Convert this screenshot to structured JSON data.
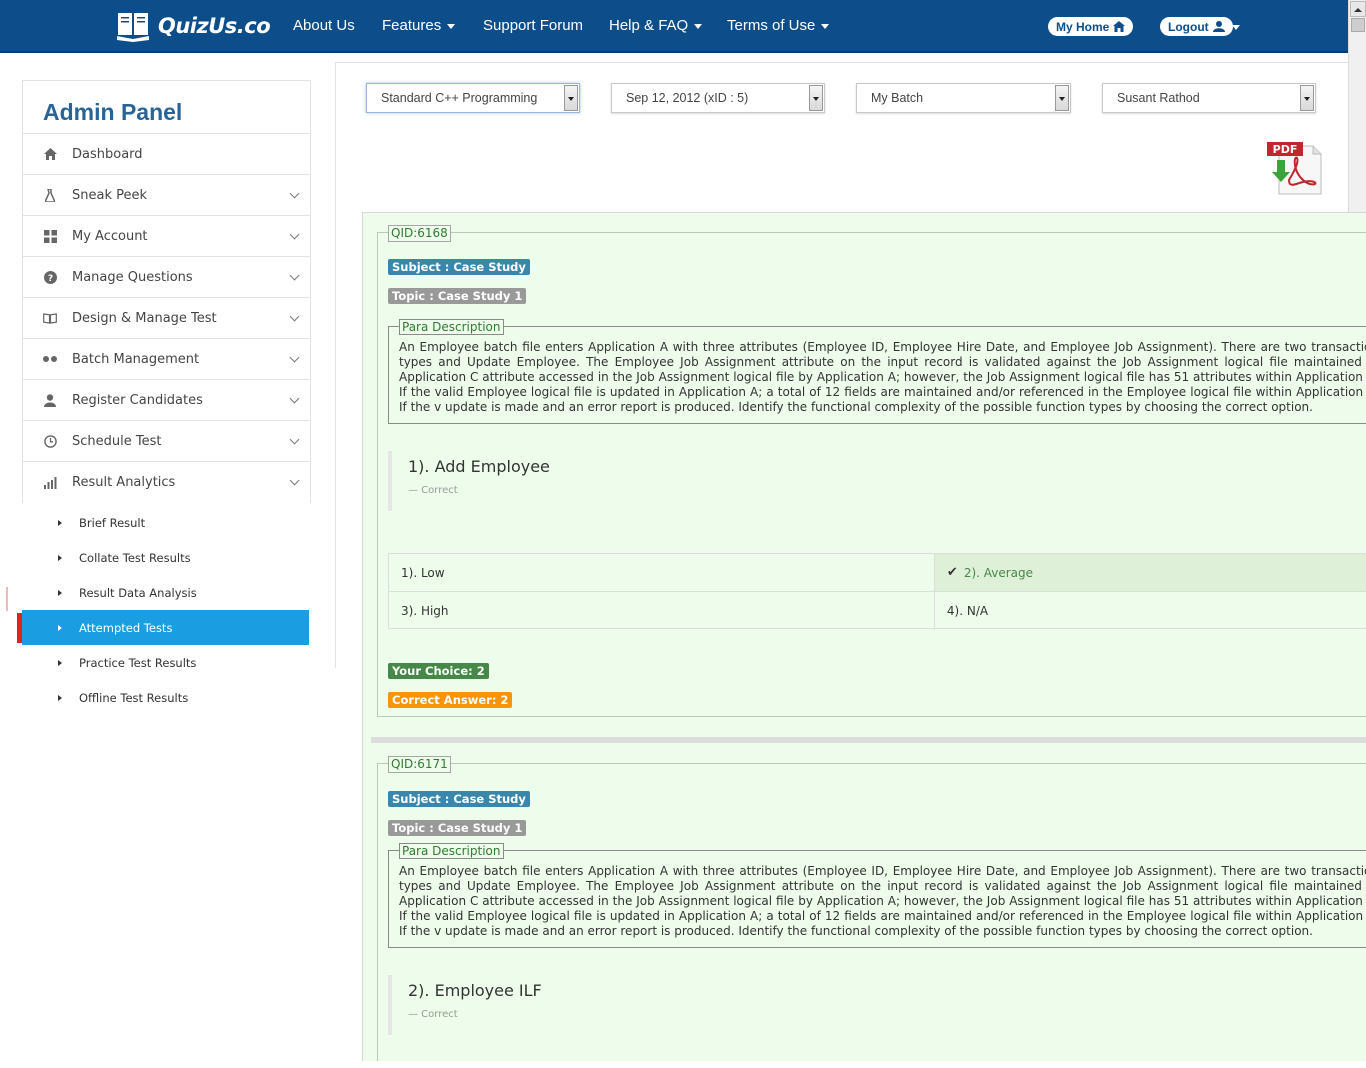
{
  "navbar": {
    "brand": "QuizUs.co",
    "items": [
      {
        "label": "About Us",
        "dropdown": false
      },
      {
        "label": "Features",
        "dropdown": true
      },
      {
        "label": "Support Forum",
        "dropdown": false
      },
      {
        "label": "Help & FAQ",
        "dropdown": true
      },
      {
        "label": "Terms of Use",
        "dropdown": true
      }
    ],
    "my_home": "My Home",
    "logout": "Logout"
  },
  "sidebar": {
    "title": "Admin Panel",
    "items": [
      {
        "label": "Dashboard",
        "icon": "home-icon",
        "expandable": false
      },
      {
        "label": "Sneak Peek",
        "icon": "flask-icon",
        "expandable": true
      },
      {
        "label": "My Account",
        "icon": "grid-icon",
        "expandable": true
      },
      {
        "label": "Manage Questions",
        "icon": "question-circle-icon",
        "expandable": true
      },
      {
        "label": "Design & Manage Test",
        "icon": "book-icon",
        "expandable": true
      },
      {
        "label": "Batch Management",
        "icon": "dots-icon",
        "expandable": true
      },
      {
        "label": "Register Candidates",
        "icon": "user-icon",
        "expandable": true
      },
      {
        "label": "Schedule Test",
        "icon": "clock-icon",
        "expandable": true
      },
      {
        "label": "Result Analytics",
        "icon": "bar-chart-icon",
        "expandable": true
      }
    ],
    "subitems": [
      {
        "label": "Brief Result",
        "active": false
      },
      {
        "label": "Collate Test Results",
        "active": false
      },
      {
        "label": "Result Data Analysis",
        "active": false
      },
      {
        "label": "Attempted Tests",
        "active": true
      },
      {
        "label": "Practice Test Results",
        "active": false
      },
      {
        "label": "Offline Test Results",
        "active": false
      }
    ]
  },
  "filters": {
    "course": "Standard C++ Programming",
    "date": "Sep 12, 2012 (xID : 5)",
    "batch": "My Batch",
    "candidate": "Susant Rathod"
  },
  "pdf_label": "PDF",
  "questions": [
    {
      "qid": "QID:6168",
      "subject": "Subject : Case Study",
      "topic": "Topic : Case Study 1",
      "para_legend": "Para Description",
      "para": "An Employee batch file enters Application A with three attributes (Employee ID, Employee Hire Date, and Employee Job Assignment). There are two transaction types and Update Employee. The Employee Job Assignment attribute on the input record is validated against the Job Assignment logical file maintained in Application C attribute accessed in the Job Assignment logical file by Application A; however, the Job Assignment logical file has 51 attributes within Application C. If the valid Employee logical file is updated in Application A; a total of 12 fields are maintained and/or referenced in the Employee logical file within Application A. If the v update is made and an error report is produced. Identify the functional complexity of the possible function types by choosing the correct option.",
      "question": "1). Add Employee",
      "status": "— Correct",
      "options": [
        "1). Low",
        "2). Average",
        "3). High",
        "4). N/A"
      ],
      "selected_index": 1,
      "your_choice": "Your Choice: 2",
      "correct_answer": "Correct Answer: 2"
    },
    {
      "qid": "QID:6171",
      "subject": "Subject : Case Study",
      "topic": "Topic : Case Study 1",
      "para_legend": "Para Description",
      "para": "An Employee batch file enters Application A with three attributes (Employee ID, Employee Hire Date, and Employee Job Assignment). There are two transaction types and Update Employee. The Employee Job Assignment attribute on the input record is validated against the Job Assignment logical file maintained in Application C attribute accessed in the Job Assignment logical file by Application A; however, the Job Assignment logical file has 51 attributes within Application C. If the valid Employee logical file is updated in Application A; a total of 12 fields are maintained and/or referenced in the Employee logical file within Application A. If the v update is made and an error report is produced. Identify the functional complexity of the possible function types by choosing the correct option.",
      "question": "2). Employee ILF",
      "status": "— Correct"
    }
  ]
}
